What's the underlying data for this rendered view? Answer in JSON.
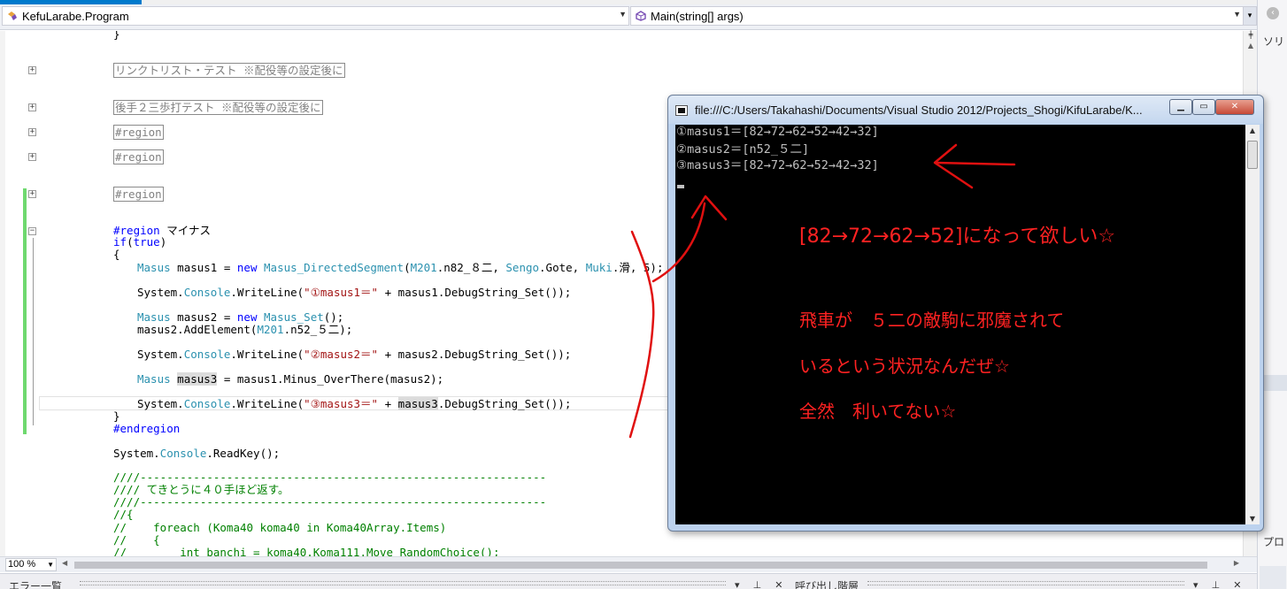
{
  "navbar": {
    "class_combo": "KefuLarabe.Program",
    "member_combo": "Main(string[] args)"
  },
  "side_panel": {
    "top_label": "ソリ",
    "bottom_label": "プロ"
  },
  "code": {
    "closing_brace": "}",
    "collapsed_region_1": "リンクトリスト・テスト ※配役等の設定後に",
    "collapsed_region_2": "後手２三歩打テスト ※配役等の設定後に",
    "region_a": "#region",
    "region_b": "#region",
    "region_c": "#region",
    "region_kw": "#region",
    "region_name": " マイナス",
    "if_kw": "if",
    "if_open": "(",
    "if_true": "true",
    "if_close": ")",
    "open_brace": "{",
    "l1_type": "Masus",
    "l1_mid": " masus1 = ",
    "l1_new": "new",
    "l1_space": " ",
    "l1_ctor": "Masus_DirectedSegment",
    "l1_p1": "(",
    "l1_m201": "M201",
    "l1_p2": ".n82_８二, ",
    "l1_sengo": "Sengo",
    "l1_p3": ".Gote, ",
    "l1_muki": "Muki",
    "l1_p4": ".滑, 5);",
    "l2_sys": "System.",
    "l2_console": "Console",
    "l2_mid": ".WriteLine(",
    "l2_str": "\"①masus1＝\"",
    "l2_tail": " + masus1.DebugString_Set());",
    "l3_type": "Masus",
    "l3_mid": " masus2 = ",
    "l3_new": "new",
    "l3_space": " ",
    "l3_ctor": "Masus_Set",
    "l3_tail": "();",
    "l4_head": "masus2.AddElement(",
    "l4_m201": "M201",
    "l4_tail": ".n52_５二);",
    "l5_sys": "System.",
    "l5_console": "Console",
    "l5_mid": ".WriteLine(",
    "l5_str": "\"②masus2＝\"",
    "l5_tail": " + masus2.DebugString_Set());",
    "l6_type": "Masus",
    "l6_space": " ",
    "l6_var": "masus3",
    "l6_tail": " = masus1.Minus_OverThere(masus2);",
    "l7_sys": "System.",
    "l7_console": "Console",
    "l7_mid": ".WriteLine(",
    "l7_str": "\"③masus3＝\"",
    "l7_plus": " + ",
    "l7_var": "masus3",
    "l7_tail": ".DebugString_Set());",
    "close_brace": "}",
    "endregion": "#endregion",
    "l8_sys": "System.",
    "l8_console": "Console",
    "l8_tail": ".ReadKey();",
    "c1": "////-------------------------------------------------------------",
    "c2": "//// てきとうに４０手ほど返す。",
    "c3": "////-------------------------------------------------------------",
    "c4": "//{",
    "c5": "//    foreach (Koma40 koma40 in Koma40Array.Items)",
    "c6": "//    {",
    "c7": "//        int banchi = koma40.Koma111.Move_RandomChoice();"
  },
  "console": {
    "title": "file:///C:/Users/Takahashi/Documents/Visual Studio 2012/Projects_Shogi/KifuLarabe/K...",
    "line1": "①masus1＝[82→72→62→52→42→32]",
    "line2": "②masus2＝[n52_５二]",
    "line3": "③masus3＝[82→72→62→52→42→32]",
    "note1": "[82→72→62→52]になって欲しい☆",
    "note2": "飛車が　５二の敵駒に邪魔されて",
    "note3": "いるという状況なんだぜ☆",
    "note4": "全然　利いてない☆"
  },
  "status": {
    "zoom": "100 %",
    "error_list": "エラー一覧",
    "call_hierarchy": "呼び出し階層"
  },
  "colors": {
    "keyword": "#0000ff",
    "type": "#2b91af",
    "string": "#a31515",
    "comment": "#008000",
    "annotation": "#ff2222",
    "console_bg": "#000000"
  },
  "icons": {
    "class_combo": "csharp-class-icon",
    "member_combo": "method-icon"
  }
}
